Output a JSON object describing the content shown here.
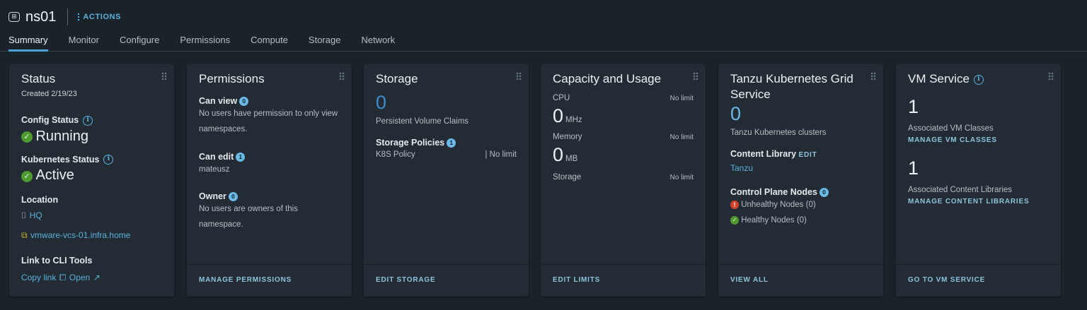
{
  "header": {
    "title": "ns01",
    "actions_label": "ACTIONS"
  },
  "tabs": [
    "Summary",
    "Monitor",
    "Configure",
    "Permissions",
    "Compute",
    "Storage",
    "Network"
  ],
  "status": {
    "title": "Status",
    "created": "Created 2/19/23",
    "config_label": "Config Status",
    "config_value": "Running",
    "k8s_label": "Kubernetes Status",
    "k8s_value": "Active",
    "location_label": "Location",
    "location_dc": "HQ",
    "location_vc": "vmware-vcs-01.infra.home",
    "cli_label": "Link to CLI Tools",
    "copy_link": "Copy link",
    "open": "Open"
  },
  "permissions": {
    "title": "Permissions",
    "can_view": "Can view",
    "can_view_count": "0",
    "can_view_text": "No users have permission to only view namespaces.",
    "can_edit": "Can edit",
    "can_edit_count": "1",
    "can_edit_user": "mateusz",
    "owner": "Owner",
    "owner_count": "0",
    "owner_text": "No users are owners of this namespace.",
    "footer": "MANAGE PERMISSIONS"
  },
  "storage": {
    "title": "Storage",
    "pvc_count": "0",
    "pvc_label": "Persistent Volume Claims",
    "policies_label": "Storage Policies",
    "policies_count": "1",
    "policy_name": "K8S Policy",
    "policy_limit": "| No limit",
    "footer": "EDIT STORAGE"
  },
  "capacity": {
    "title": "Capacity and Usage",
    "cpu_label": "CPU",
    "cpu_limit": "No limit",
    "cpu_value": "0",
    "cpu_unit": "MHz",
    "mem_label": "Memory",
    "mem_limit": "No limit",
    "mem_value": "0",
    "mem_unit": "MB",
    "storage_label": "Storage",
    "storage_limit": "No limit",
    "footer": "EDIT LIMITS"
  },
  "tkg": {
    "title": "Tanzu Kubernetes Grid Service",
    "clusters_count": "0",
    "clusters_label": "Tanzu Kubernetes clusters",
    "content_library_label": "Content Library",
    "edit": "EDIT",
    "content_library": "Tanzu",
    "cp_label": "Control Plane Nodes",
    "cp_count": "0",
    "unhealthy": "Unhealthy Nodes (0)",
    "healthy": "Healthy Nodes (0)",
    "footer": "VIEW ALL"
  },
  "vmservice": {
    "title": "VM Service",
    "vm_classes_count": "1",
    "vm_classes_label": "Associated VM Classes",
    "manage_vm_classes": "MANAGE VM CLASSES",
    "libraries_count": "1",
    "libraries_label": "Associated Content Libraries",
    "manage_libraries": "MANAGE CONTENT LIBRARIES",
    "footer": "GO TO VM SERVICE"
  }
}
